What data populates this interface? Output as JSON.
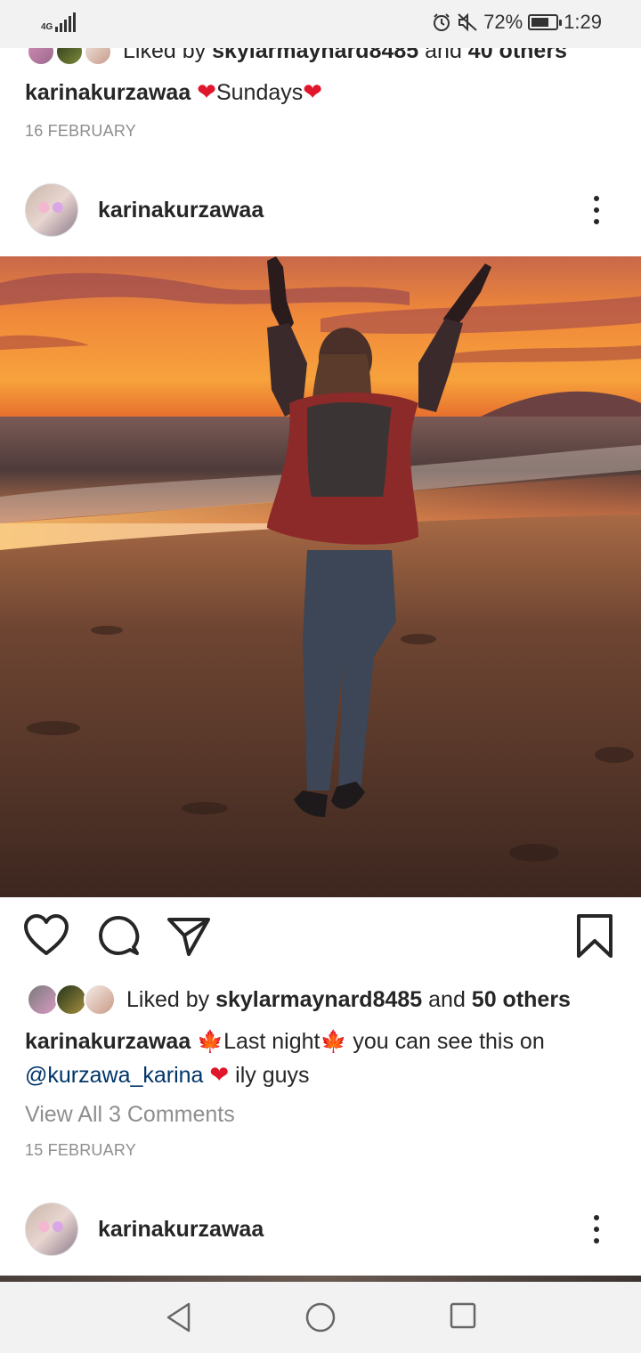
{
  "status_bar": {
    "network": "4G",
    "battery_percent": "72%",
    "battery_level": 0.72,
    "time": "1:29",
    "icons": [
      "signal-icon",
      "alarm-icon",
      "mute-icon",
      "battery-icon"
    ]
  },
  "prev_post": {
    "likes_prefix": "Liked by ",
    "likes_user": "skylarmaynard8485",
    "likes_mid": " and ",
    "likes_count": "40 others",
    "caption_user": "karinakurzawaa",
    "caption_text": "Sundays",
    "date": "16 FEBRUARY"
  },
  "post": {
    "username": "karinakurzawaa",
    "likes_prefix": "Liked by ",
    "likes_user": "skylarmaynard8485",
    "likes_mid": " and ",
    "likes_count": "50 others",
    "caption_user": "karinakurzawaa",
    "caption_part1": "Last night",
    "caption_part2": " you can see this on",
    "caption_mention": "@kurzawa_karina",
    "caption_part3": " ily guys",
    "view_comments": "View All 3 Comments",
    "date": "15 FEBRUARY"
  },
  "next_post": {
    "username": "karinakurzawaa"
  },
  "colors": {
    "text": "#262626",
    "muted": "#8e8e8e",
    "mention": "#003569",
    "heart": "#e0162b"
  }
}
